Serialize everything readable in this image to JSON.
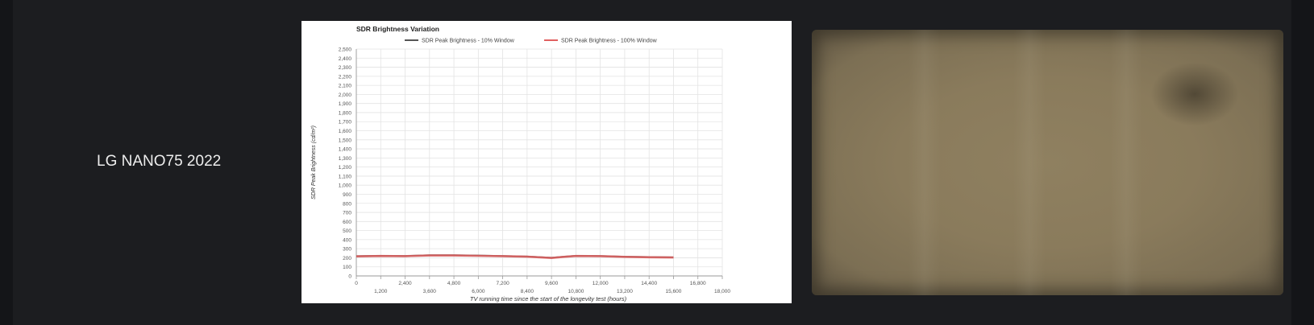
{
  "product": {
    "name": "LG NANO75 2022"
  },
  "chart_data": {
    "type": "line",
    "title": "SDR Brightness Variation",
    "xlabel": "TV running time since the start of the longevity test (hours)",
    "ylabel": "SDR Peak Brightness (cd/m²)",
    "xlim": [
      0,
      18000
    ],
    "ylim": [
      0,
      2500
    ],
    "xticks_top": [
      0,
      2400,
      4800,
      7200,
      9600,
      12000,
      14400,
      16800
    ],
    "xticks_bottom": [
      1200,
      3600,
      6000,
      8400,
      10800,
      13200,
      15600,
      18000
    ],
    "yticks": [
      0,
      100,
      200,
      300,
      400,
      500,
      600,
      700,
      800,
      900,
      1000,
      1100,
      1200,
      1300,
      1400,
      1500,
      1600,
      1700,
      1800,
      1900,
      2000,
      2100,
      2200,
      2300,
      2400,
      2500
    ],
    "grid": true,
    "legend": "top",
    "series": [
      {
        "name": "SDR Peak Brightness - 10% Window",
        "color": "#555555",
        "x": [
          0,
          1200,
          2400,
          3600,
          4800,
          6000,
          7200,
          8400,
          9600,
          10200,
          10800,
          12000,
          13200,
          14400,
          15600
        ],
        "values": [
          218,
          222,
          220,
          228,
          228,
          225,
          220,
          214,
          200,
          212,
          222,
          220,
          212,
          208,
          205
        ]
      },
      {
        "name": "SDR Peak Brightness - 100% Window",
        "color": "#e06060",
        "x": [
          0,
          1200,
          2400,
          3600,
          4800,
          6000,
          7200,
          8400,
          9600,
          10200,
          10800,
          12000,
          13200,
          14400,
          15600
        ],
        "values": [
          215,
          220,
          218,
          225,
          225,
          222,
          218,
          212,
          198,
          210,
          220,
          218,
          210,
          206,
          203
        ]
      }
    ]
  },
  "photo": {
    "tint": "#8a7b5c"
  }
}
